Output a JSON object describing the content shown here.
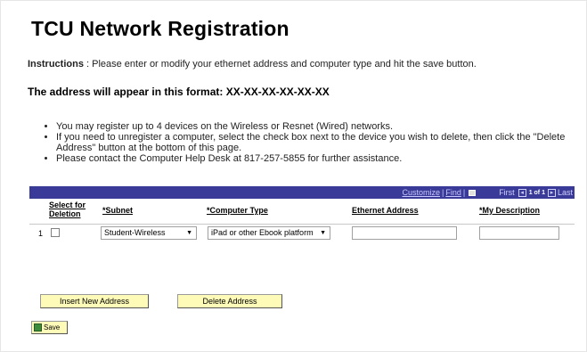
{
  "page": {
    "title": "TCU Network Registration",
    "instructions_label": "Instructions",
    "instructions_text": " : Please enter or modify your ethernet address and computer type and hit the save button.",
    "format_text": "The address will appear in this format: XX-XX-XX-XX-XX-XX"
  },
  "bullets": [
    "You may register up to 4 devices on the Wireless or Resnet (Wired) networks.",
    "If you need to unregister a computer, select the check box next to the device you wish to delete, then click the \"Delete Address\" button at the bottom of this page.",
    "Please contact the Computer Help Desk at 817-257-5855 for further assistance."
  ],
  "grid": {
    "toolbar": {
      "customize": "Customize",
      "find": "Find",
      "first": "First",
      "position": "1 of 1",
      "last": "Last"
    },
    "columns": {
      "select": "Select for Deletion",
      "subnet": "*Subnet",
      "computer_type": "*Computer Type",
      "ethernet": "Ethernet Address",
      "description": "*My Description"
    },
    "rows": [
      {
        "num": "1",
        "subnet": "Student-Wireless",
        "computer_type": "iPad or other Ebook platform",
        "ethernet": "",
        "description": ""
      }
    ]
  },
  "buttons": {
    "insert": "Insert New Address",
    "delete": "Delete Address",
    "save": "Save"
  },
  "colors": {
    "grid_bar": "#3a3a99",
    "button_bg": "#fefbb8"
  }
}
